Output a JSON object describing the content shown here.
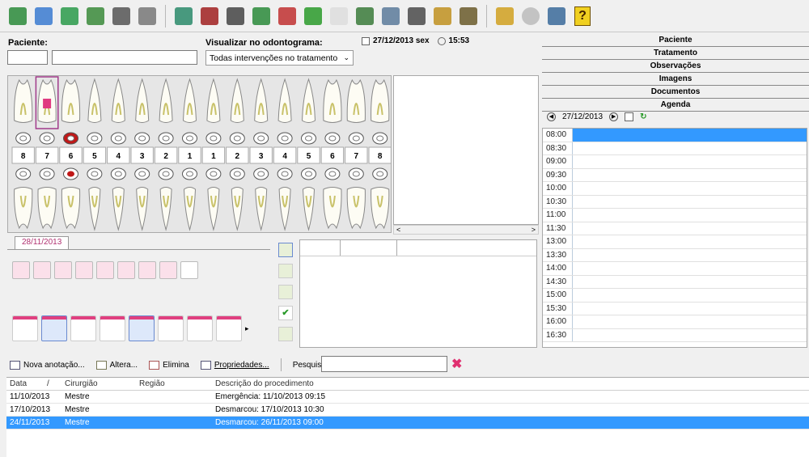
{
  "toolbar": {
    "icons": [
      "patient-search-icon",
      "patient-edit-icon",
      "patients-icon",
      "record-book-icon",
      "document-lock-icon",
      "files-icon",
      "treatment-icon",
      "phone-book-icon",
      "printer-icon",
      "money-transfer-icon",
      "gift-icon",
      "globe-icon",
      "mail-icon",
      "reports-icon",
      "list-icon",
      "pen-icon",
      "tools-icon",
      "plant-icon",
      "note-icon",
      "cd-icon",
      "books-icon",
      "help-icon"
    ],
    "help_glyph": "?"
  },
  "patient": {
    "label": "Paciente:",
    "code": "",
    "name": ""
  },
  "view": {
    "label": "Visualizar no odontograma:",
    "selected": "Todas intervenções no tratamento"
  },
  "datetime": {
    "date": "27/12/2013 sex",
    "time": "15:53"
  },
  "teeth": {
    "upper_numbers": [
      "8",
      "7",
      "6",
      "5",
      "4",
      "3",
      "2",
      "1",
      "1",
      "2",
      "3",
      "4",
      "5",
      "6",
      "7",
      "8"
    ]
  },
  "date_tab": "28/11/2013",
  "right_links": [
    "Paciente",
    "Tratamento",
    "Observações",
    "Imagens",
    "Documentos",
    "Agenda"
  ],
  "agenda": {
    "date": "27/12/2013",
    "times": [
      "08:00",
      "08:30",
      "09:00",
      "09:30",
      "10:00",
      "10:30",
      "11:00",
      "11:30",
      "13:00",
      "13:30",
      "14:00",
      "14:30",
      "15:00",
      "15:30",
      "16:00",
      "16:30"
    ]
  },
  "actions": {
    "new_note": "Nova anotação...",
    "edit": "Altera...",
    "delete": "Elimina",
    "properties": "Propriedades...",
    "search_label": "Pesquisa:",
    "search_value": ""
  },
  "table": {
    "headers": {
      "date": "Data",
      "sort": "/",
      "surgeon": "Cirurgião",
      "region": "Região",
      "description": "Descrição do procedimento"
    },
    "rows": [
      {
        "date": "11/10/2013",
        "surgeon": "Mestre",
        "region": "",
        "description": "Emergência: 11/10/2013 09:15"
      },
      {
        "date": "17/10/2013",
        "surgeon": "Mestre",
        "region": "",
        "description": "Desmarcou: 17/10/2013 10:30"
      },
      {
        "date": "24/11/2013",
        "surgeon": "Mestre",
        "region": "",
        "description": "Desmarcou: 26/11/2013 09:00"
      }
    ]
  }
}
